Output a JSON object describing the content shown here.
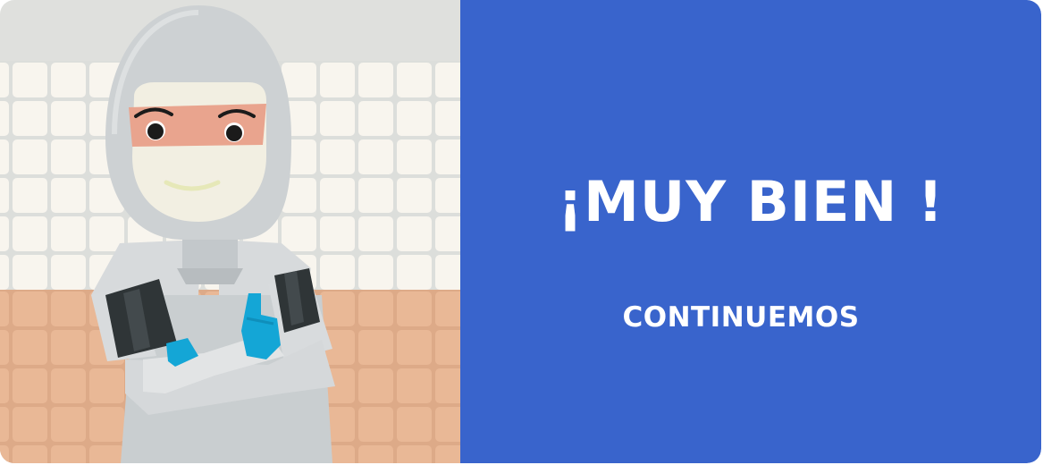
{
  "feedback": {
    "headline": "¡MUY BIEN !",
    "continue_label": "CONTINUEMOS"
  },
  "colors": {
    "panel": "#3964cc",
    "text": "#ffffff",
    "wall_tiles": "#f8f5ee",
    "wall_lower": "#e8b38f",
    "suit": "#c8cdd0",
    "gloves": "#14a6d6"
  },
  "illustration": {
    "subject": "worker-in-protective-suit-icon"
  }
}
